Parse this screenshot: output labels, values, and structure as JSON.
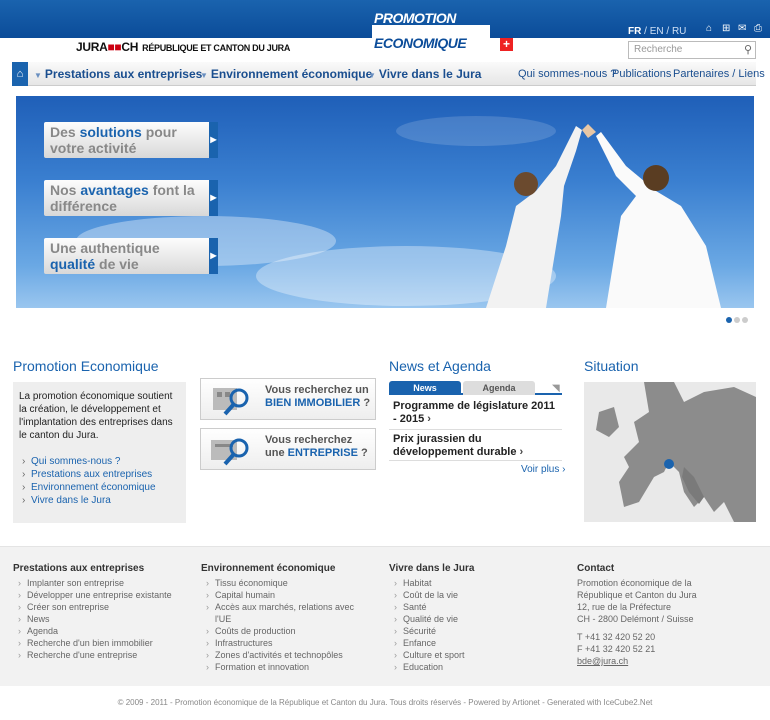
{
  "header": {
    "jura_logo_left": "JURA",
    "jura_logo_mid": "CH",
    "jura_logo_right": "RÉPUBLIQUE ET CANTON DU JURA",
    "promo_line1": "PROMOTION",
    "promo_line2": "ECONOMIQUE",
    "languages": {
      "fr": "FR",
      "en": "EN",
      "ru": "RU",
      "sep": "/"
    },
    "search_placeholder": "Recherche"
  },
  "nav": {
    "items": [
      "Prestations aux entreprises",
      "Environnement économique",
      "Vivre dans le Jura"
    ],
    "right_items": [
      "Qui sommes-nous ?",
      "Publications",
      "Partenaires / Liens"
    ]
  },
  "hero": {
    "slides": [
      {
        "pre": "Des ",
        "em": "solutions",
        "post": " pour",
        "line2": "votre activité"
      },
      {
        "pre": "Nos ",
        "em": "avantages",
        "post": " font la",
        "line2": "différence"
      },
      {
        "pre": "Une authentique",
        "em": "qualité",
        "post": " de vie"
      }
    ],
    "current_slide": 1,
    "slide_count": 3
  },
  "promotion": {
    "title": "Promotion Economique",
    "text": "La promotion économique soutient la création, le développement et l'implantation des entreprises dans le canton du Jura.",
    "links": [
      "Qui sommes-nous ?",
      "Prestations aux entreprises",
      "Environnement économique",
      "Vivre dans le Jura"
    ]
  },
  "cards": [
    {
      "line1": "Vous recherchez un",
      "line2": "BIEN IMMOBILIER",
      "suffix": " ?"
    },
    {
      "line1": "Vous recherchez",
      "pre2": "une ",
      "line2": "ENTREPRISE",
      "suffix": " ?"
    }
  ],
  "news": {
    "title": "News et Agenda",
    "tabs": [
      "News",
      "Agenda"
    ],
    "items": [
      "Programme de législature 2011 - 2015",
      "Prix jurassien du développement durable"
    ],
    "more": "Voir plus"
  },
  "situation": {
    "title": "Situation"
  },
  "footer": {
    "columns": [
      {
        "title": "Prestations aux entreprises",
        "items": [
          "Implanter son entreprise",
          "Développer une entreprise existante",
          "Créer son entreprise",
          "News",
          "Agenda",
          "Recherche d'un bien immobilier",
          "Recherche d'une entreprise"
        ]
      },
      {
        "title": "Environnement économique",
        "items": [
          "Tissu économique",
          "Capital humain",
          "Accès aux marchés, relations avec l'UE",
          "Coûts de production",
          "Infrastructures",
          "Zones d'activités et technopôles",
          "Formation et innovation"
        ]
      },
      {
        "title": "Vivre dans le Jura",
        "items": [
          "Habitat",
          "Coût de la vie",
          "Santé",
          "Qualité de vie",
          "Sécurité",
          "Enfance",
          "Culture et sport",
          "Education"
        ]
      }
    ],
    "contact": {
      "title": "Contact",
      "lines": [
        "Promotion économique de la",
        "République et Canton du Jura",
        "12, rue de la Préfecture",
        "CH - 2800 Delémont / Suisse"
      ],
      "tel": "T +41 32 420 52 20",
      "fax": "F +41 32 420 52 21",
      "email": "bde@jura.ch"
    },
    "copyright": "© 2009 - 2011 - Promotion économique de la République et Canton du Jura. Tous droits réservés - Powered by Artionet - Generated with IceCube2.Net"
  },
  "colors": {
    "brand_blue": "#1a63ae",
    "swiss_red": "#e22"
  }
}
